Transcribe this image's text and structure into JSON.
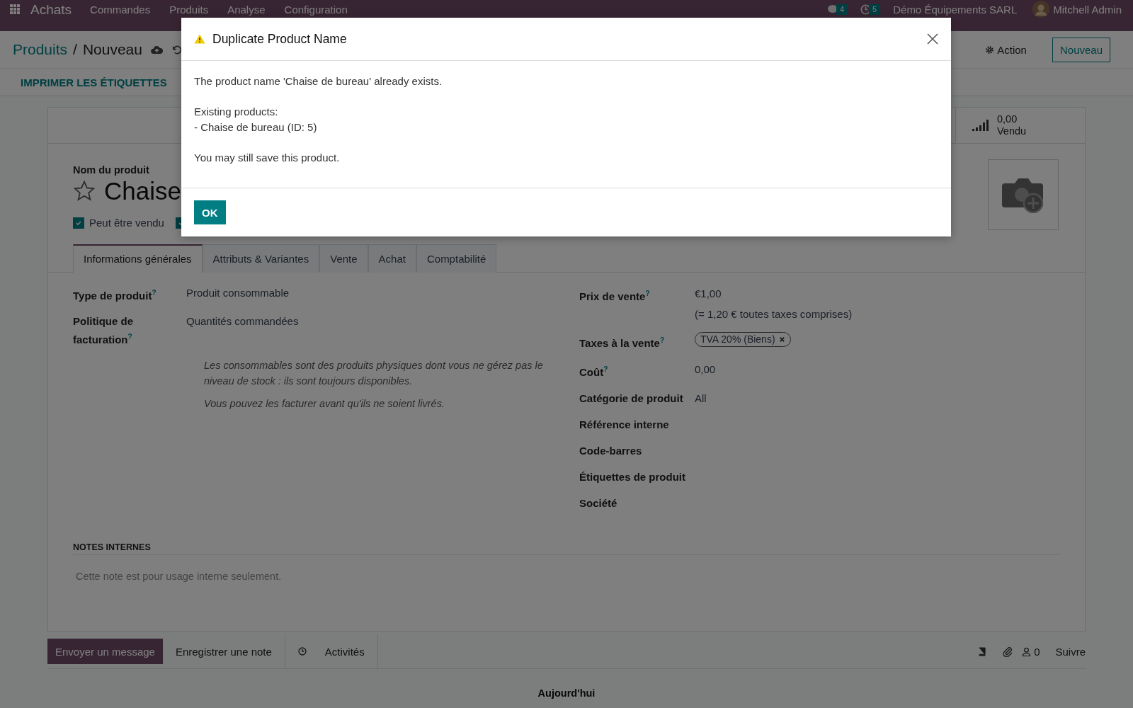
{
  "navbar": {
    "app": "Achats",
    "menu": [
      "Commandes",
      "Produits",
      "Analyse",
      "Configuration"
    ],
    "messages_count": "4",
    "activities_count": "5",
    "company": "Démo Équipements SARL",
    "user": "Mitchell Admin"
  },
  "breadcrumb": {
    "parent": "Produits",
    "separator": "/",
    "current": "Nouveau"
  },
  "actions": {
    "action": "Action",
    "new": "Nouveau"
  },
  "print_button": "IMPRIMER LES ÉTIQUETTES",
  "stat": {
    "value": "0,00",
    "label": "Vendu"
  },
  "product": {
    "name_label": "Nom du produit",
    "name": "Chaise",
    "favorite": false,
    "options": [
      {
        "label": "Peut être vendu",
        "checked": true
      },
      {
        "checked": true
      }
    ]
  },
  "tabs": [
    {
      "label": "Informations générales",
      "selected": true
    },
    {
      "label": "Attributs & Variantes",
      "selected": false
    },
    {
      "label": "Vente",
      "selected": false
    },
    {
      "label": "Achat",
      "selected": false
    },
    {
      "label": "Comptabilité",
      "selected": false
    }
  ],
  "left_fields": [
    {
      "label": "Type de produit$^{?}$",
      "value": "Produit consommable"
    },
    {
      "label": "Politique de facturation$^{?}$",
      "value": "Quantités commandées"
    }
  ],
  "hints": [
    "Les consommables sont des produits physiques dont vous ne gérez pas le niveau de stock : ils sont toujours disponibles.",
    "Vous pouvez les facturer avant qu'ils ne soient livrés."
  ],
  "right_fields": [
    {
      "kind": "text",
      "label": "Prix de vente$^{?}$",
      "value": "€1,00",
      "note": "(= 1,20 € toutes taxes comprises)"
    },
    {
      "kind": "tag",
      "label": "Taxes à la vente$^{?}$",
      "value": "TVA 20% (Biens)"
    },
    {
      "kind": "text",
      "label": "Coût$^{?}$",
      "value": "0,00"
    },
    {
      "kind": "text",
      "label": "Catégorie de produit",
      "value": "All"
    },
    {
      "kind": "text",
      "label": "Référence interne"
    },
    {
      "kind": "text",
      "label": "Code-barres"
    },
    {
      "kind": "text",
      "label": "Étiquettes de produit"
    },
    {
      "kind": "text",
      "label": "Société"
    }
  ],
  "notes": {
    "title": "NOTES INTERNES",
    "placeholder": "Cette note est pour usage interne seulement."
  },
  "chatter": {
    "send": "Envoyer un message",
    "log": "Enregistrer une note",
    "activities": "Activités",
    "followers": "0",
    "follow": "Suivre",
    "today": "Aujourd'hui"
  },
  "dialog": {
    "title": "Duplicate Product Name",
    "paragraphs": [
      [
        "The product name 'Chaise de bureau' already exists."
      ],
      [
        "Existing products:",
        "- Chaise de bureau (ID: 5)"
      ],
      [
        "You may still save this product."
      ]
    ],
    "button": "OK"
  }
}
